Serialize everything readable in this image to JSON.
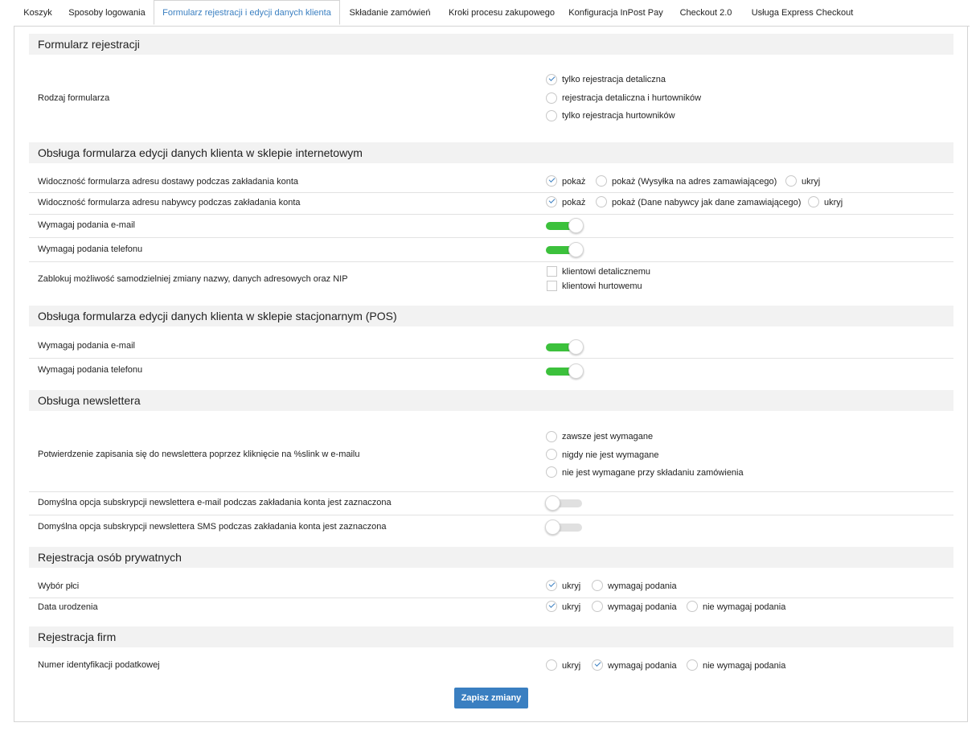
{
  "tabs": [
    {
      "label": "Koszyk"
    },
    {
      "label": "Sposoby logowania"
    },
    {
      "label": "Formularz rejestracji i edycji danych klienta"
    },
    {
      "label": "Składanie zamówień"
    },
    {
      "label": "Kroki procesu zakupowego"
    },
    {
      "label": "Konfiguracja InPost Pay"
    },
    {
      "label": "Checkout 2.0"
    },
    {
      "label": "Usługa Express Checkout"
    }
  ],
  "active_tab_index": 2,
  "sections": {
    "registration": {
      "title": "Formularz rejestracji",
      "form_type": {
        "label": "Rodzaj formularza",
        "options": [
          "tylko rejestracja detaliczna",
          "rejestracja detaliczna i hurtowników",
          "tylko rejestracja hurtowników"
        ],
        "selected": "tylko rejestracja detaliczna"
      }
    },
    "shop_edit": {
      "title": "Obsługa formularza edycji danych klienta w sklepie internetowym",
      "delivery_visibility": {
        "label": "Widoczność formularza adresu dostawy podczas zakładania konta",
        "options": [
          "pokaż",
          "pokaż (Wysyłka na adres zamawiającego)",
          "ukryj"
        ],
        "selected": "pokaż"
      },
      "buyer_visibility": {
        "label": "Widoczność formularza adresu nabywcy podczas zakładania konta",
        "options": [
          "pokaż",
          "pokaż (Dane nabywcy jak dane zamawiającego)",
          "ukryj"
        ],
        "selected": "pokaż"
      },
      "require_email": {
        "label": "Wymagaj podania e-mail",
        "enabled": true
      },
      "require_phone": {
        "label": "Wymagaj podania telefonu",
        "enabled": true
      },
      "lock_changes": {
        "label": "Zablokuj możliwość samodzielniej zmiany nazwy, danych adresowych oraz NIP",
        "options": [
          {
            "label": "klientowi detalicznemu",
            "checked": false
          },
          {
            "label": "klientowi hurtowemu",
            "checked": false
          }
        ]
      }
    },
    "pos_edit": {
      "title": "Obsługa formularza edycji danych klienta w sklepie stacjonarnym (POS)",
      "require_email": {
        "label": "Wymagaj podania e-mail",
        "enabled": true
      },
      "require_phone": {
        "label": "Wymagaj podania telefonu",
        "enabled": true
      }
    },
    "newsletter": {
      "title": "Obsługa newslettera",
      "confirmation": {
        "label": "Potwierdzenie zapisania się do newslettera poprzez kliknięcie na %slink w e-mailu",
        "options": [
          "zawsze jest wymagane",
          "nigdy nie jest wymagane",
          "nie jest wymagane przy składaniu zamówienia"
        ],
        "selected": ""
      },
      "default_email": {
        "label": "Domyślna opcja subskrypcji newslettera e-mail podczas zakładania konta jest zaznaczona",
        "enabled": false
      },
      "default_sms": {
        "label": "Domyślna opcja subskrypcji newslettera SMS podczas zakładania konta jest zaznaczona",
        "enabled": false
      }
    },
    "private": {
      "title": "Rejestracja osób prywatnych",
      "gender": {
        "label": "Wybór płci",
        "options": [
          "ukryj",
          "wymagaj podania"
        ],
        "selected": "ukryj"
      },
      "birthdate": {
        "label": "Data urodzenia",
        "options": [
          "ukryj",
          "wymagaj podania",
          "nie wymagaj podania"
        ],
        "selected": "ukryj"
      }
    },
    "companies": {
      "title": "Rejestracja firm",
      "tax_id": {
        "label": "Numer identyfikacji podatkowej",
        "options": [
          "ukryj",
          "wymagaj podania",
          "nie wymagaj podania"
        ],
        "selected": "wymagaj podania"
      }
    }
  },
  "save_button": {
    "label": "Zapisz zmiany"
  },
  "colors": {
    "accent": "#3a7fc1",
    "toggle_on": "#3cc13c",
    "section_bg": "#f2f2f2"
  }
}
